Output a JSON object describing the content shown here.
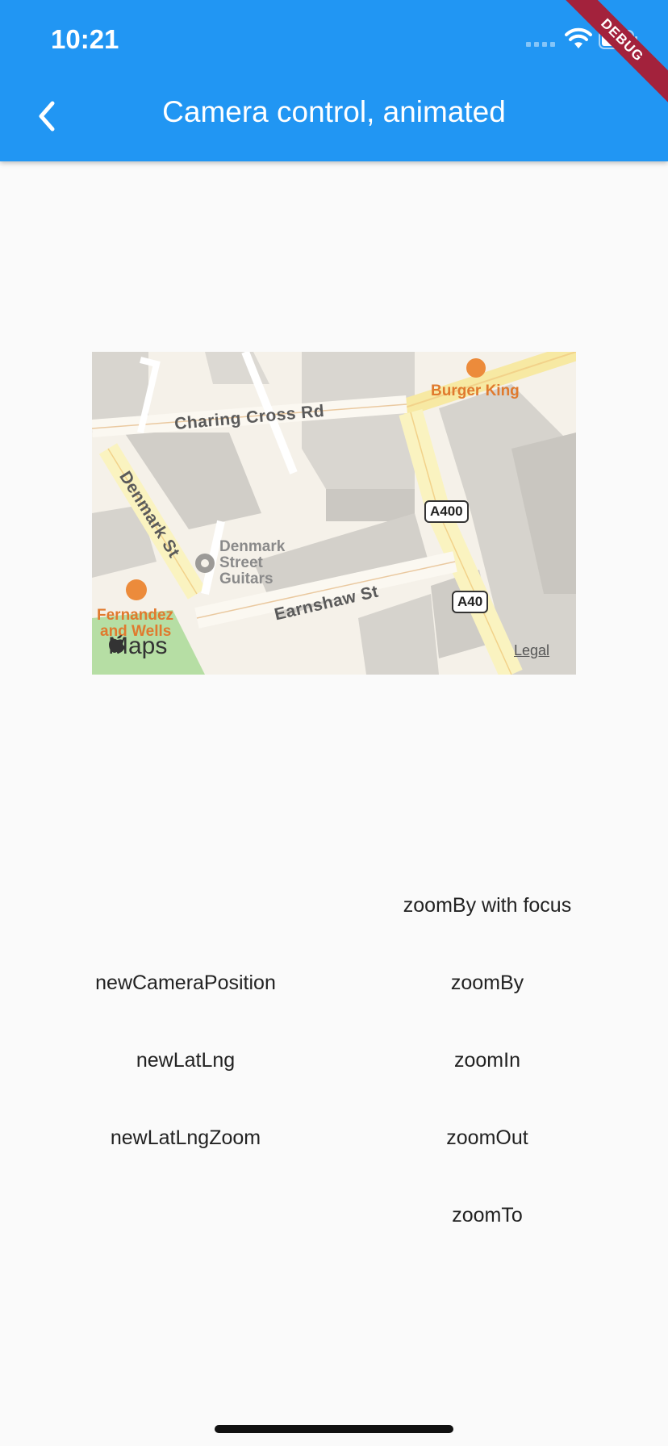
{
  "status_bar": {
    "time": "10:21"
  },
  "debug_banner": {
    "label": "DEBUG",
    "color": "#a3223c"
  },
  "app_bar": {
    "title": "Camera control, animated",
    "background": "#2196f3",
    "back_icon": "chevron-left-icon"
  },
  "map": {
    "streets": [
      "Charing Cross Rd",
      "Denmark St",
      "Earnshaw St"
    ],
    "pois": {
      "burger_king": "Burger King",
      "fernandez_line1": "Fernandez",
      "fernandez_line2": "and Wells",
      "guitars_line1": "Denmark",
      "guitars_line2": "Street",
      "guitars_line3": "Guitars"
    },
    "road_shields": [
      "A400",
      "A40"
    ],
    "logo_text": "Maps",
    "legal": "Legal"
  },
  "buttons": {
    "left": [
      "newCameraPosition",
      "newLatLng",
      "newLatLngZoom"
    ],
    "right": [
      "zoomBy with focus",
      "zoomBy",
      "zoomIn",
      "zoomOut",
      "zoomTo"
    ]
  }
}
